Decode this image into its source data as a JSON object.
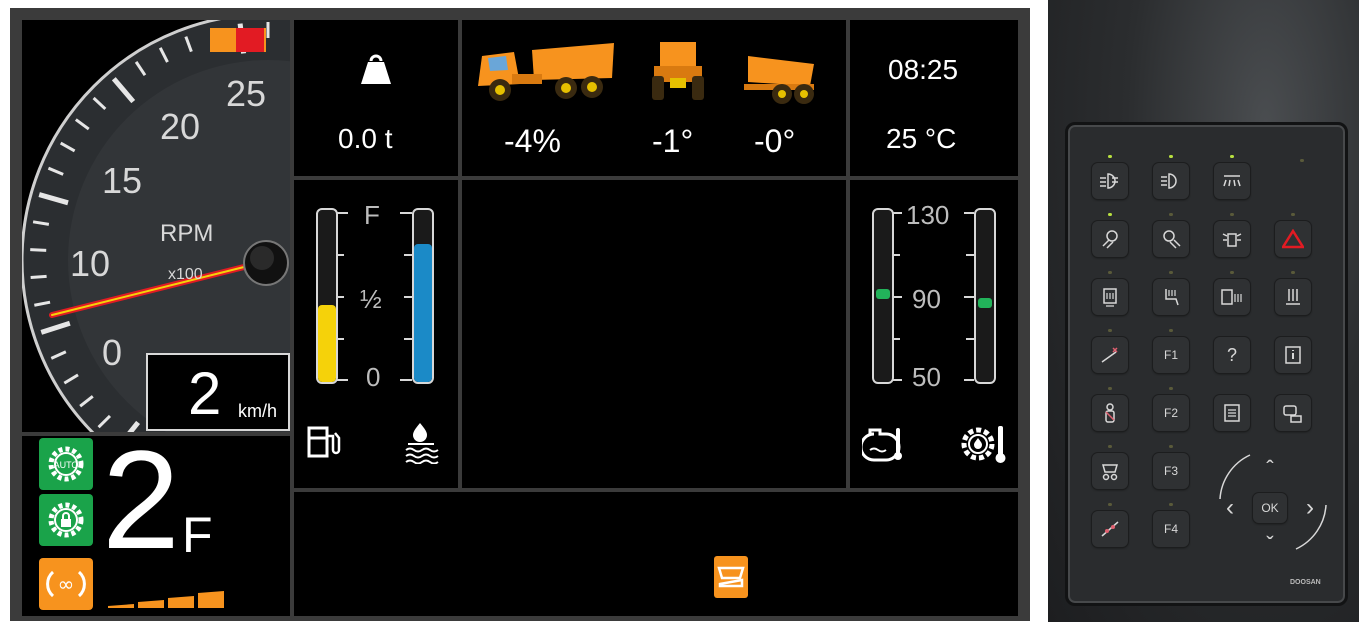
{
  "colors": {
    "orange": "#f7931e",
    "green": "#1aa34a",
    "fuel": "#f5d20a",
    "def": "#1b8ac7",
    "temp_marker": "#22b35a",
    "redline": "#e21b23"
  },
  "tachometer": {
    "label": "RPM",
    "multiplier": "x100",
    "ticks": [
      "0",
      "10",
      "15",
      "20",
      "25"
    ],
    "needle_rpm_x100": 1.5
  },
  "speed": {
    "value": "2",
    "unit": "km/h"
  },
  "gear": {
    "value": "2",
    "direction": "F",
    "auto_icon": "gear-auto-icon",
    "lock_icon": "gear-lock-icon",
    "diff_icon": "infinity-icon",
    "level_bars_filled": 4
  },
  "payload": {
    "icon": "weight-icon",
    "value": "0.0 t"
  },
  "inclination": {
    "grade": "-4%",
    "roll": "-1°",
    "body_tip": "-0°"
  },
  "clock": {
    "time": "08:25",
    "ambient_temp": "25 °C"
  },
  "levels": {
    "labels": [
      "F",
      "½",
      "0"
    ],
    "fuel_level": 0.45,
    "def_level": 0.8,
    "fuel_icon": "fuel-pump-icon",
    "def_icon": "def-fluid-icon"
  },
  "temps": {
    "labels": [
      "130",
      "90",
      "50"
    ],
    "coolant_level": 0.5,
    "oil_level": 0.44,
    "coolant_icon": "engine-coolant-icon",
    "oil_icon": "oil-temp-icon"
  },
  "status": {
    "dump_icon": "dump-body-icon"
  },
  "keypad": {
    "brand": "DOOSAN",
    "keys": [
      "F1",
      "?",
      "F2",
      "F3",
      "F4",
      "OK",
      "‹",
      "›",
      "ˆ",
      "ˇ"
    ]
  }
}
